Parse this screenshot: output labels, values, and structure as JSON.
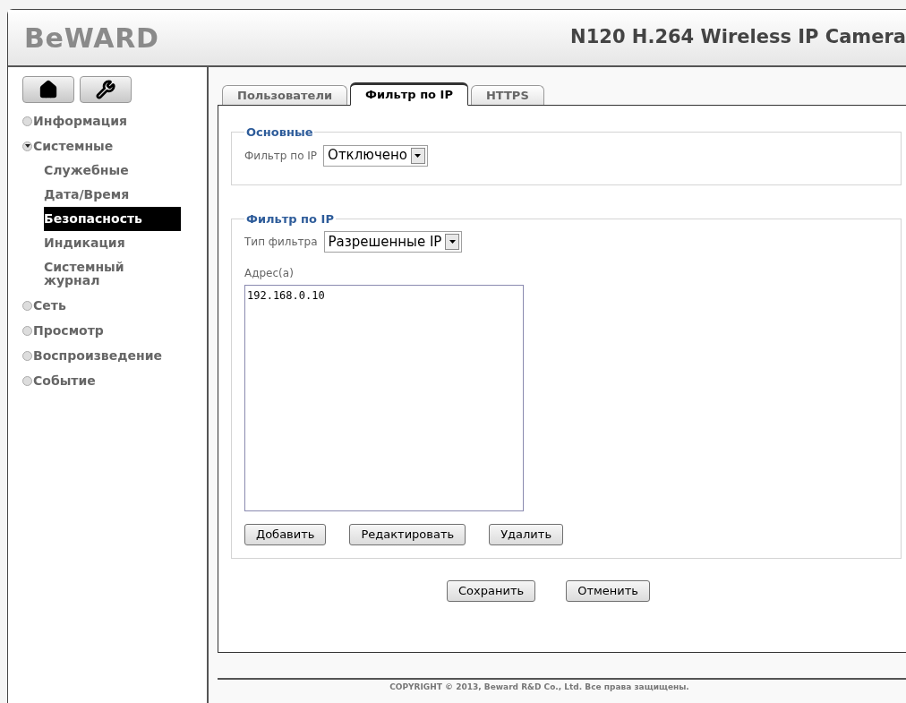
{
  "header": {
    "logo": "BeWARD",
    "title": "N120 H.264 Wireless IP Camera"
  },
  "sidebar": {
    "items": [
      {
        "label": "Информация",
        "expanded": false
      },
      {
        "label": "Системные",
        "expanded": true,
        "children": [
          {
            "label": "Служебные",
            "selected": false
          },
          {
            "label": "Дата/Время",
            "selected": false
          },
          {
            "label": "Безопасность",
            "selected": true
          },
          {
            "label": "Индикация",
            "selected": false
          },
          {
            "label": "Системный журнал",
            "selected": false
          }
        ]
      },
      {
        "label": "Сеть",
        "expanded": false
      },
      {
        "label": "Просмотр",
        "expanded": false
      },
      {
        "label": "Воспроизведение",
        "expanded": false
      },
      {
        "label": "Событие",
        "expanded": false
      }
    ]
  },
  "tabs": [
    {
      "label": "Пользователи",
      "selected": false
    },
    {
      "label": "Фильтр по IP",
      "selected": true
    },
    {
      "label": "HTTPS",
      "selected": false
    }
  ],
  "sections": [
    {
      "legend": "Основные",
      "fields": [
        {
          "label": "Фильтр по IP",
          "value": "Отключено"
        }
      ]
    },
    {
      "legend": "Фильтр по IP",
      "fields": [
        {
          "label": "Тип фильтра",
          "value": "Разрешенные IP"
        }
      ],
      "list_label": "Адрес(а)",
      "addresses": [
        "192.168.0.10"
      ],
      "buttons": [
        "Добавить",
        "Редактировать",
        "Удалить"
      ]
    }
  ],
  "actions": [
    "Сохранить",
    "Отменить"
  ],
  "footer": "COPYRIGHT © 2013, Beward R&D Co., Ltd. Все права защищены."
}
